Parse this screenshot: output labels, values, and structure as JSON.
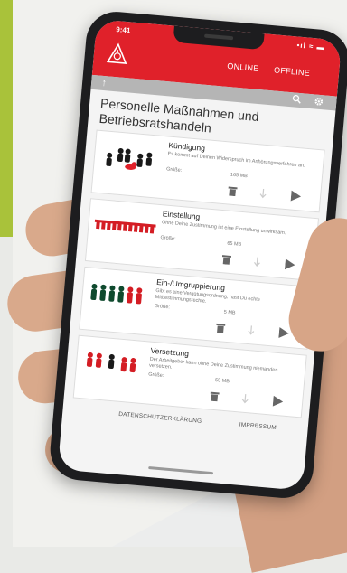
{
  "app": {
    "status_time": "9:41",
    "status_icons": "•ıl ≈ ▬",
    "modes": [
      "ONLINE",
      "OFFLINE"
    ],
    "title": "Personelle Maßnahmen und Betriebsratshandeln",
    "brand_color": "#e0212a"
  },
  "items": [
    {
      "title": "Kündigung",
      "description": "Es kommt auf Deinen Widerspruch im Anhörungsverfahren an.",
      "size_label": "Größe:",
      "size_value": "165 MB"
    },
    {
      "title": "Einstellung",
      "description": "Ohne Deine Zustimmung ist eine Einstellung unwirksam.",
      "size_label": "Größe:",
      "size_value": "65 MB"
    },
    {
      "title": "Ein-/Umgruppierung",
      "description": "Gibt es eine Vergütungsordnung, hast Du echte Mitbestimmungsrechte.",
      "size_label": "Größe:",
      "size_value": "5 MB"
    },
    {
      "title": "Versetzung",
      "description": "Der Arbeitgeber kann ohne Deine Zustimmung niemanden versetzen.",
      "size_label": "Größe:",
      "size_value": "55 MB"
    }
  ],
  "footer": {
    "privacy": "DATENSCHUTZERKLÄRUNG",
    "impressum": "IMPRESSUM"
  }
}
